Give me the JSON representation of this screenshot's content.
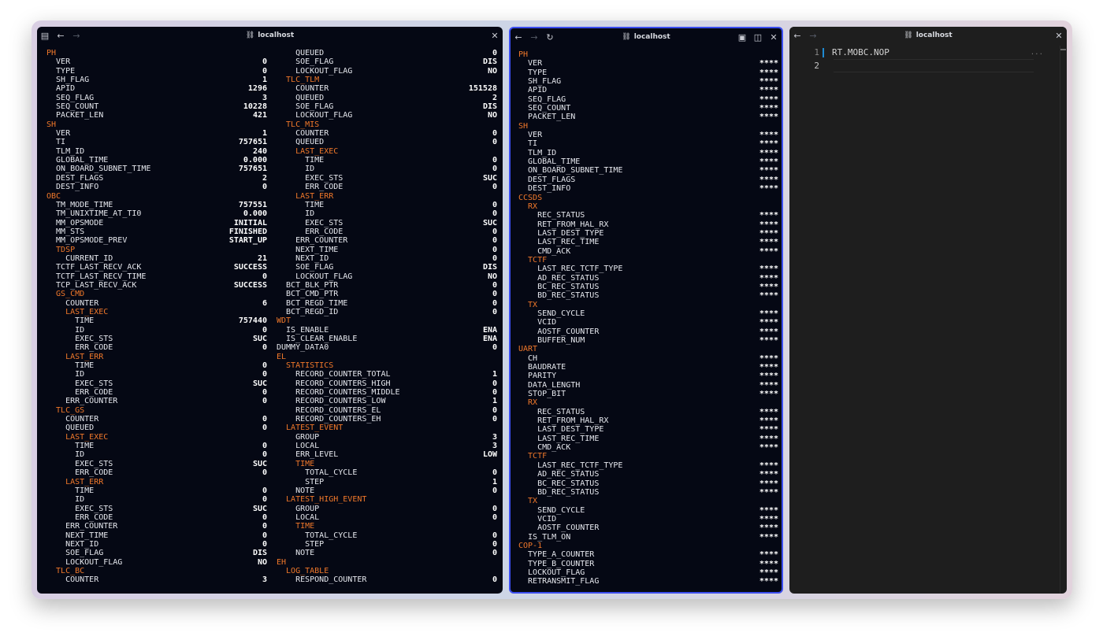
{
  "window": {
    "title_left": "localhost",
    "title_mid": "localhost",
    "title_right": "localhost"
  },
  "pane1": {
    "col1": [
      [
        "PH",
        "",
        1
      ],
      [
        "  VER",
        "0",
        0
      ],
      [
        "  TYPE",
        "0",
        0
      ],
      [
        "  SH_FLAG",
        "1",
        0
      ],
      [
        "  APID",
        "1296",
        0
      ],
      [
        "  SEQ_FLAG",
        "3",
        0
      ],
      [
        "  SEQ_COUNT",
        "10228",
        0
      ],
      [
        "  PACKET_LEN",
        "421",
        0
      ],
      [
        "SH",
        "",
        1
      ],
      [
        "  VER",
        "1",
        0
      ],
      [
        "  TI",
        "757651",
        0
      ],
      [
        "  TLM_ID",
        "240",
        0
      ],
      [
        "  GLOBAL_TIME",
        "0.000",
        0
      ],
      [
        "  ON_BOARD_SUBNET_TIME",
        "757651",
        0
      ],
      [
        "  DEST_FLAGS",
        "2",
        0
      ],
      [
        "  DEST_INFO",
        "0",
        0
      ],
      [
        "OBC",
        "",
        1
      ],
      [
        "  TM_MODE_TIME",
        "757551",
        0
      ],
      [
        "  TM_UNIXTIME_AT_TI0",
        "0.000",
        0
      ],
      [
        "  MM_OPSMODE",
        "INITIAL",
        0
      ],
      [
        "  MM_STS",
        "FINISHED",
        0
      ],
      [
        "  MM_OPSMODE_PREV",
        "START_UP",
        0
      ],
      [
        "  TDSP",
        "",
        1
      ],
      [
        "    CURRENT_ID",
        "21",
        0
      ],
      [
        "  TCTF_LAST_RECV_ACK",
        "SUCCESS",
        0
      ],
      [
        "  TCTF_LAST_RECV_TIME",
        "0",
        0
      ],
      [
        "  TCP_LAST_RECV_ACK",
        "SUCCESS",
        0
      ],
      [
        "  GS_CMD",
        "",
        1
      ],
      [
        "    COUNTER",
        "6",
        0
      ],
      [
        "    LAST_EXEC",
        "",
        1
      ],
      [
        "      TIME",
        "757440",
        0
      ],
      [
        "      ID",
        "0",
        0
      ],
      [
        "      EXEC_STS",
        "SUC",
        0
      ],
      [
        "      ERR_CODE",
        "0",
        0
      ],
      [
        "    LAST_ERR",
        "",
        1
      ],
      [
        "      TIME",
        "0",
        0
      ],
      [
        "      ID",
        "0",
        0
      ],
      [
        "      EXEC_STS",
        "SUC",
        0
      ],
      [
        "      ERR_CODE",
        "0",
        0
      ],
      [
        "    ERR_COUNTER",
        "0",
        0
      ],
      [
        "  TLC_GS",
        "",
        1
      ],
      [
        "    COUNTER",
        "0",
        0
      ],
      [
        "    QUEUED",
        "0",
        0
      ],
      [
        "    LAST_EXEC",
        "",
        1
      ],
      [
        "      TIME",
        "0",
        0
      ],
      [
        "      ID",
        "0",
        0
      ],
      [
        "      EXEC_STS",
        "SUC",
        0
      ],
      [
        "      ERR_CODE",
        "0",
        0
      ],
      [
        "    LAST_ERR",
        "",
        1
      ],
      [
        "      TIME",
        "0",
        0
      ],
      [
        "      ID",
        "0",
        0
      ],
      [
        "      EXEC_STS",
        "SUC",
        0
      ],
      [
        "      ERR_CODE",
        "0",
        0
      ],
      [
        "    ERR_COUNTER",
        "0",
        0
      ],
      [
        "    NEXT_TIME",
        "0",
        0
      ],
      [
        "    NEXT_ID",
        "0",
        0
      ],
      [
        "    SOE_FLAG",
        "DIS",
        0
      ],
      [
        "    LOCKOUT_FLAG",
        "NO",
        0
      ],
      [
        "  TLC_BC",
        "",
        1
      ],
      [
        "    COUNTER",
        "3",
        0
      ]
    ],
    "col2": [
      [
        "    QUEUED",
        "0",
        0
      ],
      [
        "    SOE_FLAG",
        "DIS",
        0
      ],
      [
        "    LOCKOUT_FLAG",
        "NO",
        0
      ],
      [
        "  TLC_TLM",
        "",
        1
      ],
      [
        "    COUNTER",
        "151528",
        0
      ],
      [
        "    QUEUED",
        "2",
        0
      ],
      [
        "    SOE_FLAG",
        "DIS",
        0
      ],
      [
        "    LOCKOUT_FLAG",
        "NO",
        0
      ],
      [
        "  TLC_MIS",
        "",
        1
      ],
      [
        "    COUNTER",
        "0",
        0
      ],
      [
        "    QUEUED",
        "0",
        0
      ],
      [
        "    LAST_EXEC",
        "",
        1
      ],
      [
        "      TIME",
        "0",
        0
      ],
      [
        "      ID",
        "0",
        0
      ],
      [
        "      EXEC_STS",
        "SUC",
        0
      ],
      [
        "      ERR_CODE",
        "0",
        0
      ],
      [
        "    LAST_ERR",
        "",
        1
      ],
      [
        "      TIME",
        "0",
        0
      ],
      [
        "      ID",
        "0",
        0
      ],
      [
        "      EXEC_STS",
        "SUC",
        0
      ],
      [
        "      ERR_CODE",
        "0",
        0
      ],
      [
        "    ERR_COUNTER",
        "0",
        0
      ],
      [
        "    NEXT_TIME",
        "0",
        0
      ],
      [
        "    NEXT_ID",
        "0",
        0
      ],
      [
        "    SOE_FLAG",
        "DIS",
        0
      ],
      [
        "    LOCKOUT_FLAG",
        "NO",
        0
      ],
      [
        "  BCT_BLK_PTR",
        "0",
        0
      ],
      [
        "  BCT_CMD_PTR",
        "0",
        0
      ],
      [
        "  BCT_REGD_TIME",
        "0",
        0
      ],
      [
        "  BCT_REGD_ID",
        "0",
        0
      ],
      [
        "WDT",
        "",
        1
      ],
      [
        "  IS_ENABLE",
        "ENA",
        0
      ],
      [
        "  IS_CLEAR_ENABLE",
        "ENA",
        0
      ],
      [
        "DUMMY_DATA0",
        "0",
        0
      ],
      [
        "EL",
        "",
        1
      ],
      [
        "  STATISTICS",
        "",
        1
      ],
      [
        "    RECORD_COUNTER_TOTAL",
        "1",
        0
      ],
      [
        "    RECORD_COUNTERS_HIGH",
        "0",
        0
      ],
      [
        "    RECORD_COUNTERS_MIDDLE",
        "0",
        0
      ],
      [
        "    RECORD_COUNTERS_LOW",
        "1",
        0
      ],
      [
        "    RECORD_COUNTERS_EL",
        "0",
        0
      ],
      [
        "    RECORD_COUNTERS_EH",
        "0",
        0
      ],
      [
        "  LATEST_EVENT",
        "",
        1
      ],
      [
        "    GROUP",
        "3",
        0
      ],
      [
        "    LOCAL",
        "3",
        0
      ],
      [
        "    ERR_LEVEL",
        "LOW",
        0
      ],
      [
        "    TIME",
        "",
        1
      ],
      [
        "      TOTAL_CYCLE",
        "0",
        0
      ],
      [
        "      STEP",
        "1",
        0
      ],
      [
        "    NOTE",
        "0",
        0
      ],
      [
        "  LATEST_HIGH_EVENT",
        "",
        1
      ],
      [
        "    GROUP",
        "0",
        0
      ],
      [
        "    LOCAL",
        "0",
        0
      ],
      [
        "    TIME",
        "",
        1
      ],
      [
        "      TOTAL_CYCLE",
        "0",
        0
      ],
      [
        "      STEP",
        "0",
        0
      ],
      [
        "    NOTE",
        "0",
        0
      ],
      [
        "EH",
        "",
        1
      ],
      [
        "  LOG_TABLE",
        "",
        1
      ],
      [
        "    RESPOND_COUNTER",
        "0",
        0
      ]
    ]
  },
  "pane2": {
    "col1": [
      [
        "PH",
        "",
        1
      ],
      [
        "  VER",
        "****",
        0
      ],
      [
        "  TYPE",
        "****",
        0
      ],
      [
        "  SH_FLAG",
        "****",
        0
      ],
      [
        "  APID",
        "****",
        0
      ],
      [
        "  SEQ_FLAG",
        "****",
        0
      ],
      [
        "  SEQ_COUNT",
        "****",
        0
      ],
      [
        "  PACKET_LEN",
        "****",
        0
      ],
      [
        "SH",
        "",
        1
      ],
      [
        "  VER",
        "****",
        0
      ],
      [
        "  TI",
        "****",
        0
      ],
      [
        "  TLM_ID",
        "****",
        0
      ],
      [
        "  GLOBAL_TIME",
        "****",
        0
      ],
      [
        "  ON_BOARD_SUBNET_TIME",
        "****",
        0
      ],
      [
        "  DEST_FLAGS",
        "****",
        0
      ],
      [
        "  DEST_INFO",
        "****",
        0
      ],
      [
        "CCSDS",
        "",
        1
      ],
      [
        "  RX",
        "",
        1
      ],
      [
        "    REC_STATUS",
        "****",
        0
      ],
      [
        "    RET_FROM_HAL_RX",
        "****",
        0
      ],
      [
        "    LAST_DEST_TYPE",
        "****",
        0
      ],
      [
        "    LAST_REC_TIME",
        "****",
        0
      ],
      [
        "    CMD_ACK",
        "****",
        0
      ],
      [
        "  TCTF",
        "",
        1
      ],
      [
        "    LAST_REC_TCTF_TYPE",
        "****",
        0
      ],
      [
        "    AD_REC_STATUS",
        "****",
        0
      ],
      [
        "    BC_REC_STATUS",
        "****",
        0
      ],
      [
        "    BD_REC_STATUS",
        "****",
        0
      ],
      [
        "  TX",
        "",
        1
      ],
      [
        "    SEND_CYCLE",
        "****",
        0
      ],
      [
        "    VCID",
        "****",
        0
      ],
      [
        "    AOSTF_COUNTER",
        "****",
        0
      ],
      [
        "    BUFFER_NUM",
        "****",
        0
      ],
      [
        "UART",
        "",
        1
      ],
      [
        "  CH",
        "****",
        0
      ],
      [
        "  BAUDRATE",
        "****",
        0
      ],
      [
        "  PARITY",
        "****",
        0
      ],
      [
        "  DATA_LENGTH",
        "****",
        0
      ],
      [
        "  STOP_BIT",
        "****",
        0
      ],
      [
        "  RX",
        "",
        1
      ],
      [
        "    REC_STATUS",
        "****",
        0
      ],
      [
        "    RET_FROM_HAL_RX",
        "****",
        0
      ],
      [
        "    LAST_DEST_TYPE",
        "****",
        0
      ],
      [
        "    LAST_REC_TIME",
        "****",
        0
      ],
      [
        "    CMD_ACK",
        "****",
        0
      ],
      [
        "  TCTF",
        "",
        1
      ],
      [
        "    LAST_REC_TCTF_TYPE",
        "****",
        0
      ],
      [
        "    AD_REC_STATUS",
        "****",
        0
      ],
      [
        "    BC_REC_STATUS",
        "****",
        0
      ],
      [
        "    BD_REC_STATUS",
        "****",
        0
      ],
      [
        "  TX",
        "",
        1
      ],
      [
        "    SEND_CYCLE",
        "****",
        0
      ],
      [
        "    VCID",
        "****",
        0
      ],
      [
        "    AOSTF_COUNTER",
        "****",
        0
      ],
      [
        "  IS_TLM_ON",
        "****",
        0
      ],
      [
        "COP-1",
        "",
        1
      ],
      [
        "  TYPE_A_COUNTER",
        "****",
        0
      ],
      [
        "  TYPE_B_COUNTER",
        "****",
        0
      ],
      [
        "  LOCKOUT_FLAG",
        "****",
        0
      ],
      [
        "  RETRANSMIT_FLAG",
        "****",
        0
      ]
    ]
  },
  "editor": {
    "lines": [
      {
        "num": "1",
        "text": "RT.MOBC.NOP"
      },
      {
        "num": "2",
        "text": ""
      }
    ],
    "ellipsis": "..."
  },
  "icons": {
    "sidebar": "sidebar-icon",
    "back": "arrow-left-icon",
    "forward": "arrow-right-icon",
    "reload": "reload-icon",
    "link": "link-icon",
    "close": "close-icon",
    "reader": "reader-icon",
    "split": "split-view-icon"
  },
  "colors": {
    "section": "#f0782a",
    "focus_border": "#3b4df0",
    "panel_bg": "#050814",
    "editor_bg": "#1e1e1e"
  }
}
